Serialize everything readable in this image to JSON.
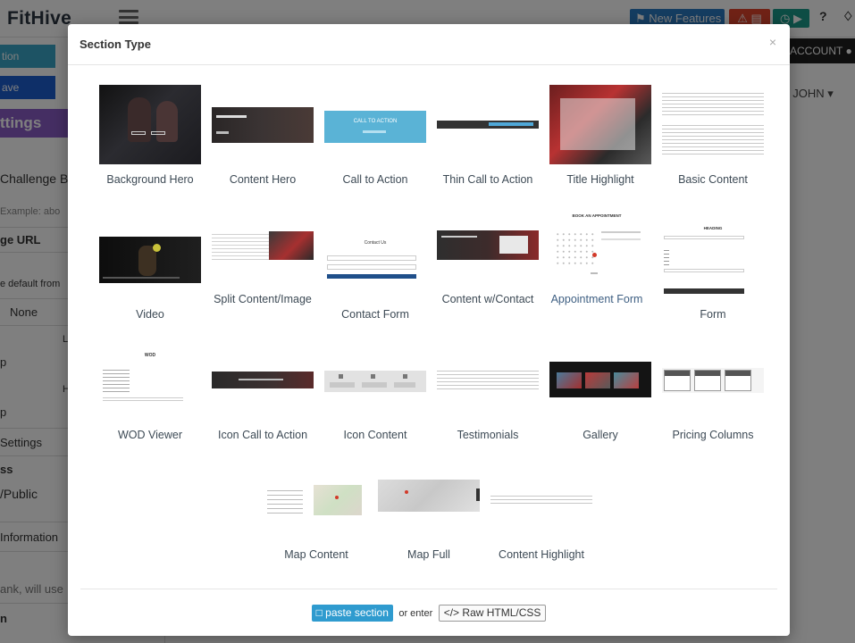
{
  "app": {
    "brand": "FitHive",
    "new_features": "New Features",
    "account": "ACCOUNT",
    "user": "I JOHN"
  },
  "sidebar": {
    "btn_top": "tion",
    "btn_save": "ave",
    "settings": "ttings",
    "lines": [
      "Challenge Bo",
      "Example: abo",
      "ge URL",
      "e default from",
      "None",
      "p",
      "L",
      "p",
      "H",
      "Settings",
      "ss",
      "/Public",
      "Information",
      "ank, will use",
      "n"
    ]
  },
  "modal": {
    "title": "Section Type",
    "close": "×",
    "tiles": [
      {
        "label": "Background Hero"
      },
      {
        "label": "Content Hero"
      },
      {
        "label": "Call to Action",
        "thumb_text": "CALL TO ACTION"
      },
      {
        "label": "Thin Call to Action"
      },
      {
        "label": "Title Highlight"
      },
      {
        "label": "Basic Content"
      },
      {
        "label": "Video"
      },
      {
        "label": "Split Content/Image"
      },
      {
        "label": "Contact Form",
        "thumb_text": "Contact Us"
      },
      {
        "label": "Content w/Contact"
      },
      {
        "label": "Appointment Form",
        "thumb_text": "BOOK AN APPOINTMENT"
      },
      {
        "label": "Form",
        "thumb_text": "HEADING"
      },
      {
        "label": "WOD Viewer",
        "thumb_text": "WOD"
      },
      {
        "label": "Icon Call to Action"
      },
      {
        "label": "Icon Content"
      },
      {
        "label": "Testimonials"
      },
      {
        "label": "Gallery"
      },
      {
        "label": "Pricing Columns"
      },
      {
        "label": "Map Content"
      },
      {
        "label": "Map Full"
      },
      {
        "label": "Content Highlight"
      }
    ],
    "highlighted": "Appointment Form",
    "footer": {
      "paste": "paste section",
      "or_enter": "or enter",
      "raw": "</> Raw HTML/CSS"
    }
  },
  "colors": {
    "brand_dark": "#2b3440",
    "paste_button": "#2f9bcf",
    "label_text": "#3d4a55",
    "backdrop": "rgba(0,0,0,0.5)"
  }
}
